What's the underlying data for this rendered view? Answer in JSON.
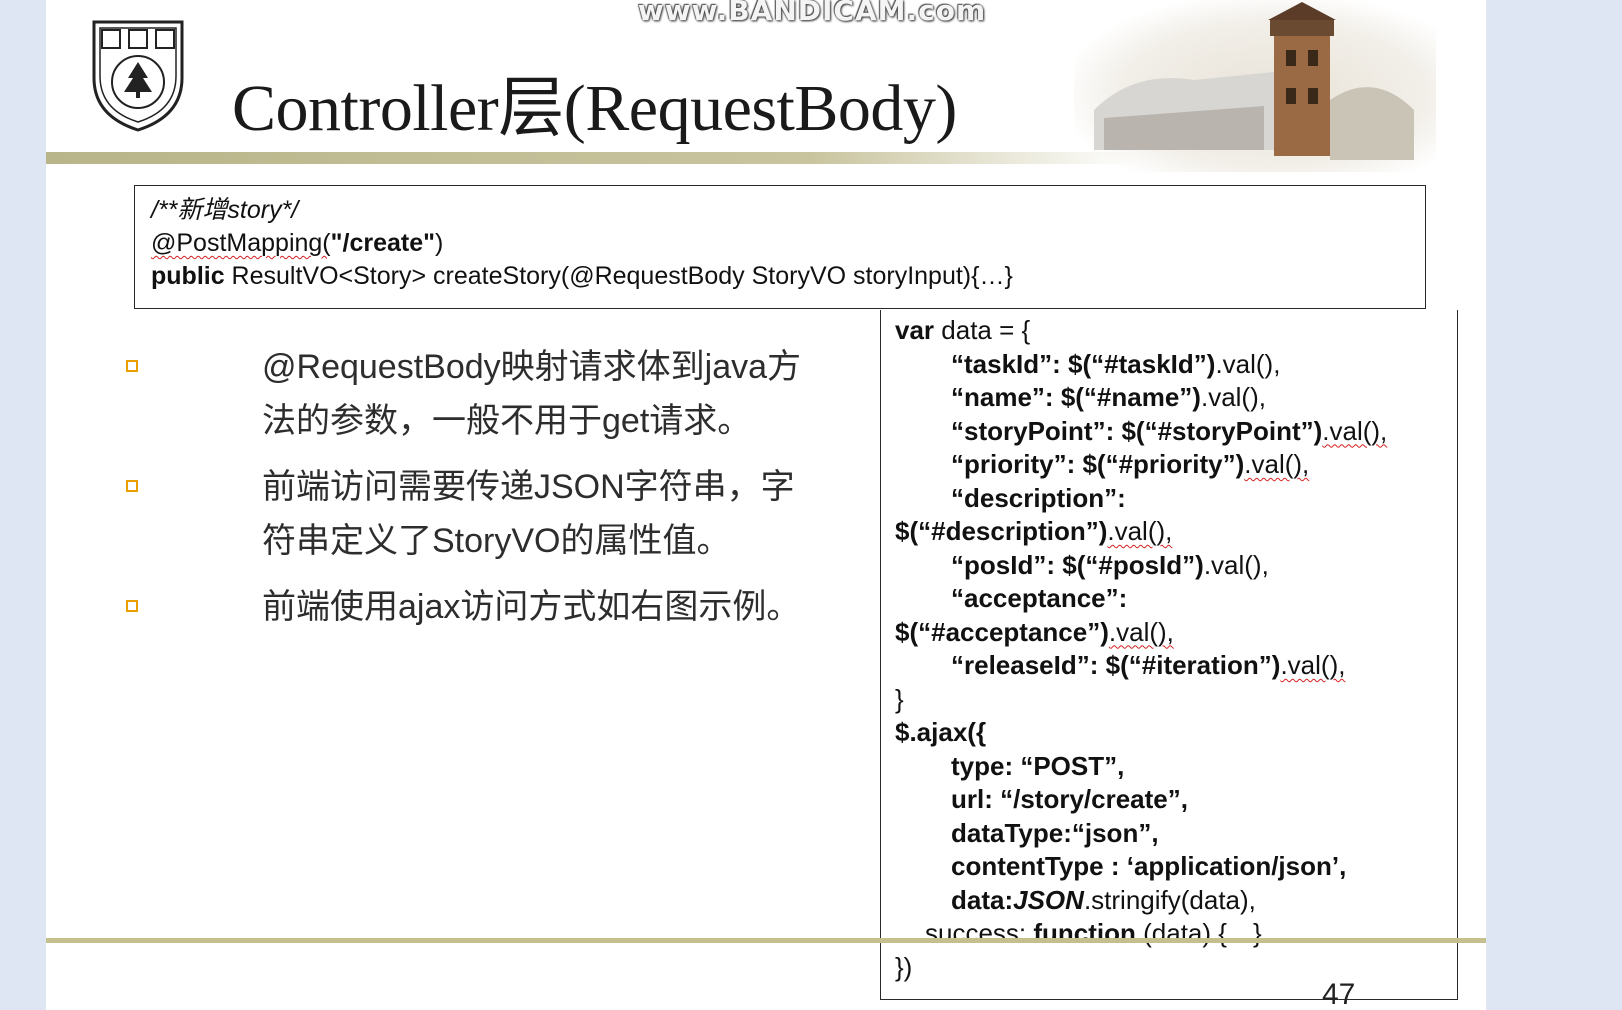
{
  "watermark": "www.BANDICAM.com",
  "slide": {
    "title": "Controller层(RequestBody)",
    "page_number": "47"
  },
  "top_code": {
    "comment": "/**新增story*/",
    "line2_a": "@PostMapping(",
    "line2_b": "\"/create\"",
    "line2_c": ")",
    "line3_keyword": "public",
    "line3_rest": " ResultVO<Story> createStory(@RequestBody StoryVO storyInput){…}"
  },
  "bullets": [
    {
      "line1": "@RequestBody映射请求体到java方",
      "line2": "法的参数，一般不用于get请求。"
    },
    {
      "line1": "前端访问需要传递JSON字符串，字",
      "line2": "符串定义了StoryVO的属性值。"
    },
    {
      "line1": "前端使用ajax访问方式如右图示例。",
      "line2": ""
    }
  ],
  "right_code": {
    "l1_kw": "var",
    "l1_rest": " data = {",
    "l2_key": "“taskId”:",
    "l2_sel": "$(“#taskId”)",
    "l2_fn": ".val(),",
    "l3_key": "“name”:",
    "l3_sel": "$(“#name”)",
    "l3_fn": ".val(),",
    "l4_key": "“storyPoint”:",
    "l4_sel": "$(“#storyPoint”)",
    "l4_fn": ".val(),",
    "l5_key": "“priority”:",
    "l5_sel": "$(“#priority”)",
    "l5_fn": ".val(),",
    "l6_key": "“description”:",
    "l7_sel": "$(“#description”)",
    "l7_fn": ".val(),",
    "l8_key": "“posId”:",
    "l8_sel": "$(“#posId”)",
    "l8_fn": ".val(),",
    "l9_key": "“acceptance”:",
    "l10_sel": "$(“#acceptance”)",
    "l10_fn": ".val(),",
    "l11_key": "“releaseId”:",
    "l11_sel": "$(“#iteration”)",
    "l11_fn": ".val(),",
    "l12": "}",
    "l13": "$.ajax({",
    "l14": "type: “POST”,",
    "l15": "url: “/story/create”,",
    "l16": "dataType:“json”,",
    "l17": "contentType : ‘application/json’,",
    "l18_a": "data:",
    "l18_b": "JSON",
    "l18_c": ".stringify(data),",
    "l19_a": "success: ",
    "l19_b": "function",
    "l19_c": " (data) {…}",
    "l20": "})"
  }
}
